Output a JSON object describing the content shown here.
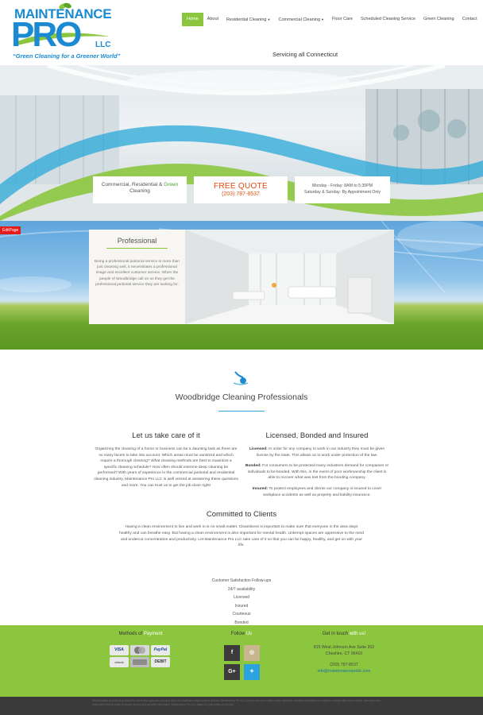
{
  "header": {
    "logo": {
      "maintenance": "MAINTENANCE",
      "pro": "PRO",
      "llc": "LLC",
      "tagline": "“Green Cleaning for a Greener World”"
    },
    "nav": [
      {
        "label": "Home",
        "active": true,
        "has_caret": false
      },
      {
        "label": "About",
        "active": false,
        "has_caret": false
      },
      {
        "label": "Residential Cleaning",
        "active": false,
        "has_caret": true
      },
      {
        "label": "Commercial Cleaning",
        "active": false,
        "has_caret": true
      },
      {
        "label": "Floor Care",
        "active": false,
        "has_caret": false
      },
      {
        "label": "Scheduled Cleaning Service",
        "active": false,
        "has_caret": false
      },
      {
        "label": "Green Cleaning",
        "active": false,
        "has_caret": false
      },
      {
        "label": "Contact",
        "active": false,
        "has_caret": false
      }
    ],
    "serving": "Servicing all Connecticut"
  },
  "hero": {
    "box1_prefix": "Commercial, Residential &",
    "box1_green": "Green",
    "box1_suffix": "Cleaning",
    "quote_title": "FREE QUOTE",
    "quote_phone": "(203) 787-8537",
    "hours_line1": "Monday - Friday: 8AM to 5:30PM",
    "hours_line2": "Saturday & Sunday: By Appointment Only"
  },
  "professional": {
    "edit_badge": "EditPage",
    "title": "Professional",
    "text": "Being a professional janitorial service is more than just cleaning well, it necessitates a professional image and excellent customer service. When the people of Woodbridge call on us they get the professional janitorial service they are looking for."
  },
  "main": {
    "title": "Woodbridge Cleaning Professionals",
    "left_title": "Let us take care of it",
    "left_text": "Organizing the cleaning of a home or business can be a daunting task as there are so many facets to take into account. Which areas must be sanitized and which require a thorough cleaning? What cleaning methods are best to maximize a specific cleaning schedule? How often should extreme deep cleaning be performed? With years of experience in the commercial janitorial and residential cleaning industry, Maintenance Pro LLC is well versed at answering these questions and more. You can trust us to get the job done right!",
    "right_title": "Licensed, Bonded and Insured",
    "licensed_label": "Licensed:",
    "licensed_text": " In order for any company to work in our industry they must be given license by the state. This allows us to work under protection of the law.",
    "bonded_label": "Bonded:",
    "bonded_text": " For consumers to be protected many industries demand for companies or individuals to be bonded. With this, in the event of poor workmanship the client is able to recover what was lost from the bonding company.",
    "insured_label": "Insured:",
    "insured_text": " To protect employees and clients our company is insured to cover workplace accidents as well as property and liability insurance.",
    "committed_title": "Committed to Clients",
    "committed_text": "Having a clean environment to live and work in is no small matter. Cleanliness is important to make sure that everyone in the area stays healthy and can breathe easy. But having a clean environment is also important for mental health. Unkempt spaces are oppressive to the mind and undercut concentration and productivity. Let Maintenance Pro LLC take care of it so that you can be happy, healthy, and get on with your life.",
    "list": [
      "Customer Satisfaction Follow-ups",
      "24/7 availability",
      "Licensed",
      "Insured",
      "Courteous",
      "Bonded"
    ]
  },
  "footer": {
    "methods_a": "Methods of",
    "methods_b": "Payment",
    "follow_a": "Follow",
    "follow_b": "Us",
    "touch_a": "Get in touch",
    "touch_b": "with us!",
    "cards": [
      "VISA",
      "MasterCard",
      "PayPal",
      "check",
      "AmEx",
      "DEBIT"
    ],
    "socials": [
      {
        "icon": "facebook-icon",
        "glyph": "f",
        "color": "#3b3b3b"
      },
      {
        "icon": "instagram-icon",
        "glyph": "◎",
        "color": "#c9b58e"
      },
      {
        "icon": "google-plus-icon",
        "glyph": "G+",
        "color": "#3b3b3b"
      },
      {
        "icon": "twitter-icon",
        "glyph": "✦",
        "color": "#2aa3e0"
      }
    ],
    "address1": "815 West Johnson Ave Suite 202",
    "address2": "Cheshire, CT 06410",
    "phone": "(203) 787-8537",
    "email": "info@maintenanceprollc.com"
  },
  "bottom": {
    "text": "All information provided is provided for information purposes only and does not constitute a legal contract between Maintenance Pro LLC and any person or entity unless otherwise specified. Information is subject to change without prior notice. Although every reasonable effort is made to present current and accurate information, Maintenance Pro LLC makes no guarantees of any kind."
  },
  "colors": {
    "accent_green": "#8cc63f",
    "brand_blue": "#1a8bd3",
    "quote_orange": "#e24b10",
    "footer_dark": "#3a3a3a"
  }
}
